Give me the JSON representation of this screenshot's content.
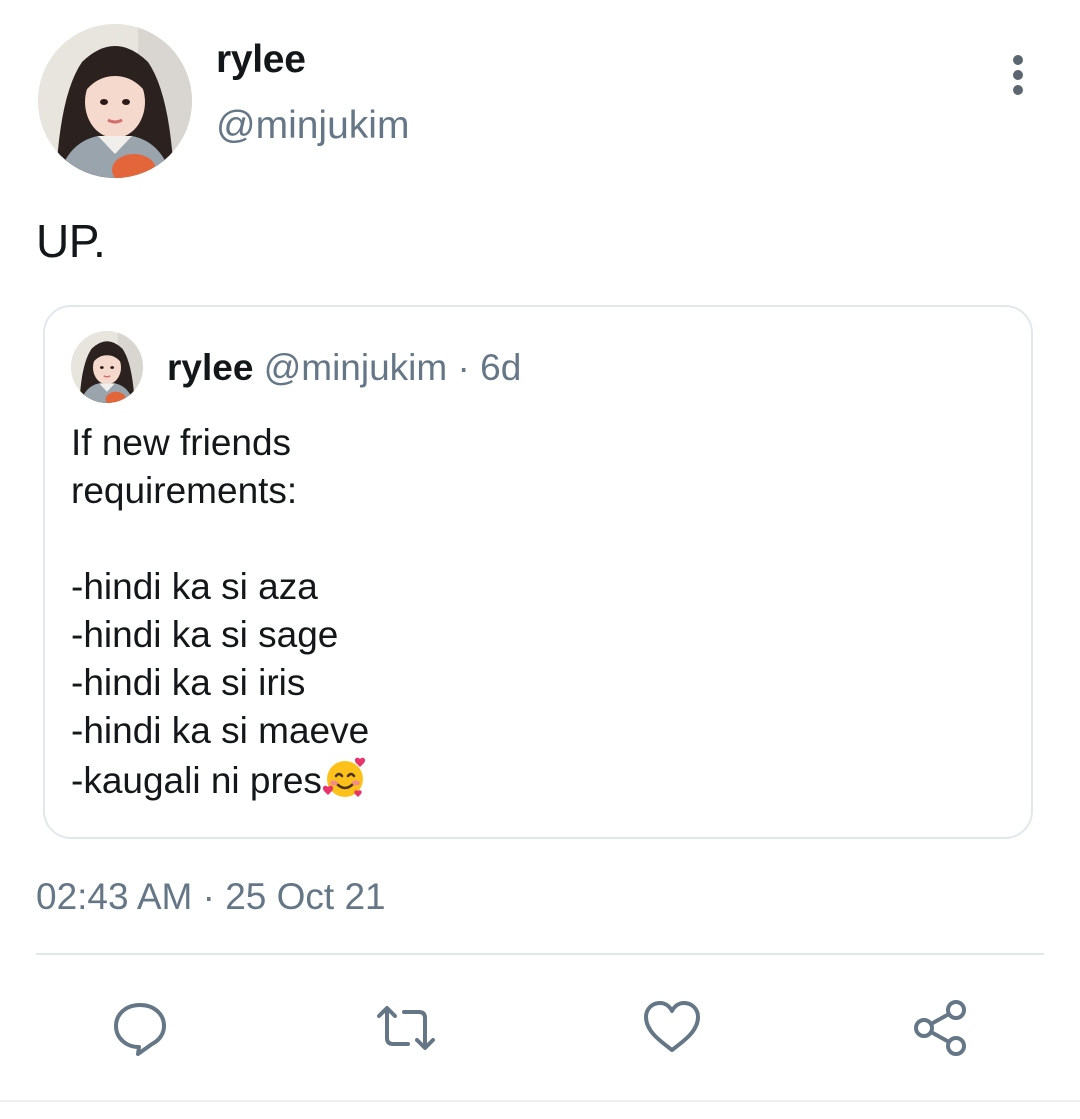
{
  "tweet": {
    "author": {
      "display_name": "rylee",
      "handle": "@minjukim",
      "avatar_icon": "profile-photo"
    },
    "text": "UP.",
    "timestamp": "02:43 AM · 25 Oct 21",
    "more_icon": "more-vertical-icon"
  },
  "quoted_tweet": {
    "display_name": "rylee",
    "handle": "@minjukim",
    "separator": "·",
    "age": "6d",
    "lines": [
      "If new friends",
      "requirements:",
      "",
      "-hindi ka si aza",
      "-hindi ka si sage",
      "-hindi ka si iris",
      "-hindi ka si maeve",
      "-kaugali ni pres"
    ],
    "trailing_emoji": "smiling-face-with-hearts"
  },
  "actions": [
    {
      "name": "reply",
      "icon": "reply-icon"
    },
    {
      "name": "retweet",
      "icon": "retweet-icon"
    },
    {
      "name": "like",
      "icon": "heart-icon"
    },
    {
      "name": "share",
      "icon": "share-icon"
    }
  ],
  "colors": {
    "text_primary": "#14171a",
    "text_secondary": "#657786",
    "border": "#e1e8ed",
    "icon": "#657786"
  }
}
